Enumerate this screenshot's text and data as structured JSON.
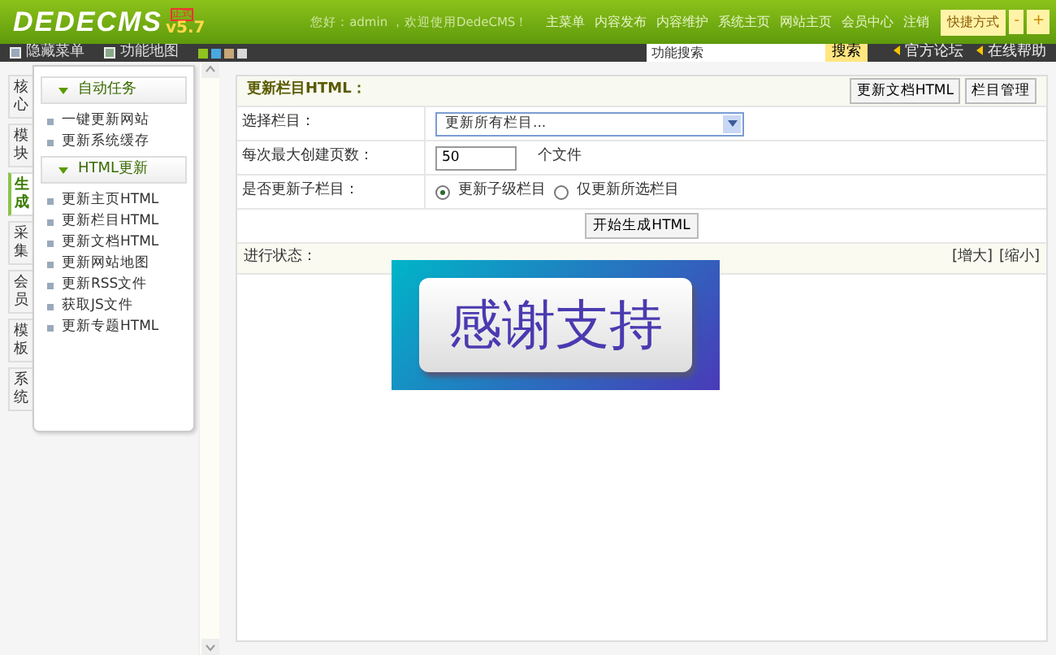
{
  "header": {
    "logo": "DEDECMS",
    "badge": "正式",
    "version": "v5.7",
    "greeting": "您好：admin ，欢迎使用DedeCMS！",
    "nav": [
      "主菜单",
      "内容发布",
      "内容维护",
      "系统主页",
      "网站主页",
      "会员中心",
      "注销"
    ],
    "shortcut": {
      "label": "快捷方式",
      "toggle": "-",
      "add": "+"
    }
  },
  "toolbar": {
    "left": [
      "隐藏菜单",
      "功能地图"
    ],
    "skins": [
      {
        "color": "#8fc31f"
      },
      {
        "color": "#4aa8e0"
      },
      {
        "color": "#c8a878"
      },
      {
        "color": "#d8d8d8"
      }
    ],
    "search": {
      "value": "功能搜索",
      "button": "搜索"
    },
    "links": [
      "官方论坛",
      "在线帮助"
    ]
  },
  "side_tabs": [
    {
      "label": "核心",
      "selected": false
    },
    {
      "label": "模块",
      "selected": false
    },
    {
      "label": "生成",
      "selected": true
    },
    {
      "label": "采集",
      "selected": false
    },
    {
      "label": "会员",
      "selected": false
    },
    {
      "label": "模板",
      "selected": false
    },
    {
      "label": "系统",
      "selected": false
    }
  ],
  "menu": [
    {
      "title": "自动任务",
      "items": [
        "一键更新网站",
        "更新系统缓存"
      ]
    },
    {
      "title": "HTML更新",
      "items": [
        "更新主页HTML",
        "更新栏目HTML",
        "更新文档HTML",
        "更新网站地图",
        "更新RSS文件",
        "获取JS文件",
        "更新专题HTML"
      ]
    }
  ],
  "panel": {
    "title": "更新栏目HTML：",
    "buttons": [
      "更新文档HTML",
      "栏目管理"
    ],
    "rows": [
      {
        "kind": "select",
        "label": "选择栏目：",
        "value": "更新所有栏目..."
      },
      {
        "kind": "number",
        "label": "每次最大创建页数：",
        "value": "50",
        "unit": "个文件"
      },
      {
        "kind": "radio",
        "label": "是否更新子栏目：",
        "options": [
          {
            "label": "更新子级栏目",
            "selected": true
          },
          {
            "label": "仅更新所选栏目",
            "selected": false
          }
        ]
      }
    ],
    "submit": "开始生成HTML",
    "status_label": "进行状态：",
    "zoom": [
      "[增大]",
      "[缩小]"
    ]
  },
  "overlay_banner": {
    "text": "感谢支持"
  }
}
